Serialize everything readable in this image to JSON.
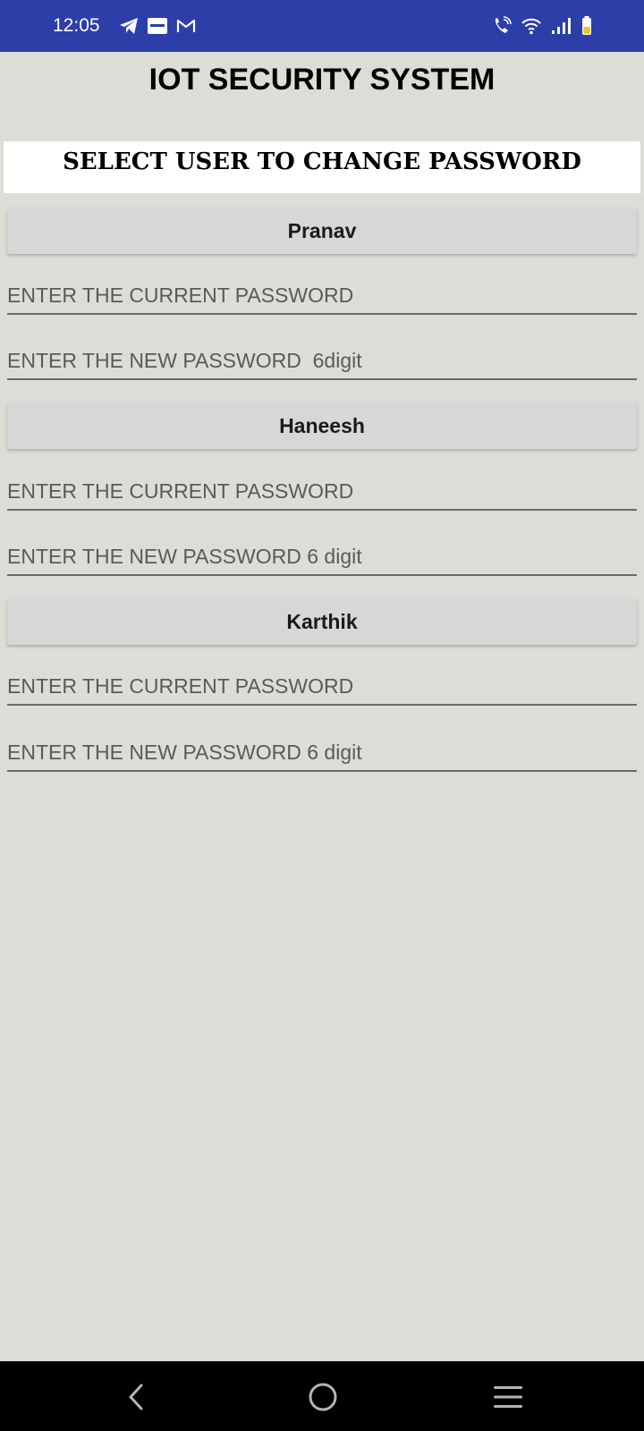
{
  "status_bar": {
    "time": "12:05",
    "left_icons": [
      "telegram-icon",
      "news-app-icon",
      "gmail-icon"
    ],
    "right_icons": [
      "wifi-calling-icon",
      "wifi-icon",
      "signal-icon",
      "battery-icon"
    ],
    "colors": {
      "background": "#2c3ea8",
      "battery_fill": "#f2c21b"
    }
  },
  "app": {
    "title": "IOT SECURITY SYSTEM"
  },
  "section": {
    "header": "SELECT USER TO CHANGE PASSWORD"
  },
  "users": [
    {
      "name": "Pranav",
      "current_password_placeholder": "ENTER THE CURRENT PASSWORD",
      "new_password_placeholder": "ENTER THE NEW PASSWORD  6digit"
    },
    {
      "name": "Haneesh",
      "current_password_placeholder": "ENTER THE CURRENT PASSWORD",
      "new_password_placeholder": "ENTER THE NEW PASSWORD 6 digit"
    },
    {
      "name": "Karthik",
      "current_password_placeholder": "ENTER THE CURRENT PASSWORD",
      "new_password_placeholder": "ENTER THE NEW PASSWORD 6 digit"
    }
  ],
  "nav_bar": {
    "buttons": [
      "back-icon",
      "home-icon",
      "recents-icon"
    ]
  },
  "colors": {
    "page_background": "#dcddd6",
    "button_background": "#d6d7d7",
    "header_background": "#ffffff"
  }
}
